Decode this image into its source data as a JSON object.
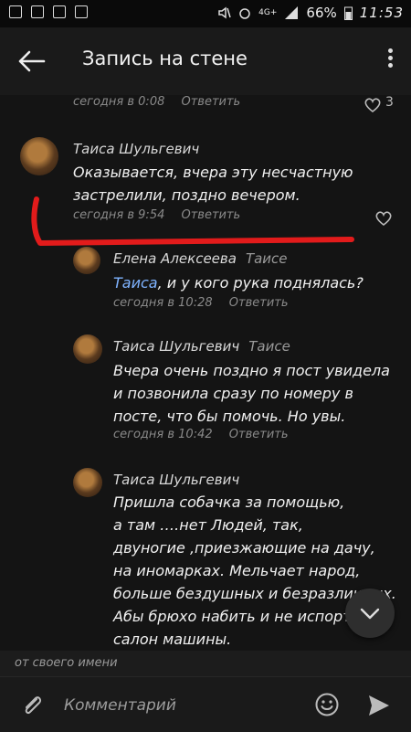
{
  "status_bar": {
    "battery": "66%",
    "time": "11:53",
    "network": "4G+"
  },
  "header": {
    "title": "Запись на стене"
  },
  "comments": [
    {
      "date": "сегодня в 0:08",
      "reply": "Ответить",
      "likes": "3"
    },
    {
      "author": "Таиса Шульгевич",
      "lines": [
        "Оказывается, вчера эту несчастную",
        "застрелили, поздно вечером."
      ],
      "date": "сегодня в 9:54",
      "reply": "Ответить"
    },
    {
      "author": "Елена Алексеева",
      "to": "Таисе",
      "mention": "Таиса",
      "text_rest": ", и у кого рука поднялась?",
      "date": "сегодня в 10:28",
      "reply": "Ответить"
    },
    {
      "author": "Таиса Шульгевич",
      "to": "Таисе",
      "lines": [
        "Вчера очень поздно я пост увидела",
        "и позвонила сразу по номеру в",
        "посте, что бы помочь. Но увы."
      ],
      "date": "сегодня в 10:42",
      "reply": "Ответить"
    },
    {
      "author": "Таиса Шульгевич",
      "lines": [
        "Пришла собачка за помощью,",
        "а там ….нет Людей, так,",
        "двуногие ,приезжающие на дачу,",
        "на   иномарках. Мельчает народ,",
        "больше бездушных и безразличных.",
        "Абы брюхо набить и не испортить",
        "салон машины."
      ]
    }
  ],
  "composer": {
    "from_label": "от своего имени",
    "placeholder": "Комментарий"
  },
  "colors": {
    "background": "#141414",
    "accent_link": "#7fb3ff",
    "annotation_red": "#e21b1b"
  }
}
